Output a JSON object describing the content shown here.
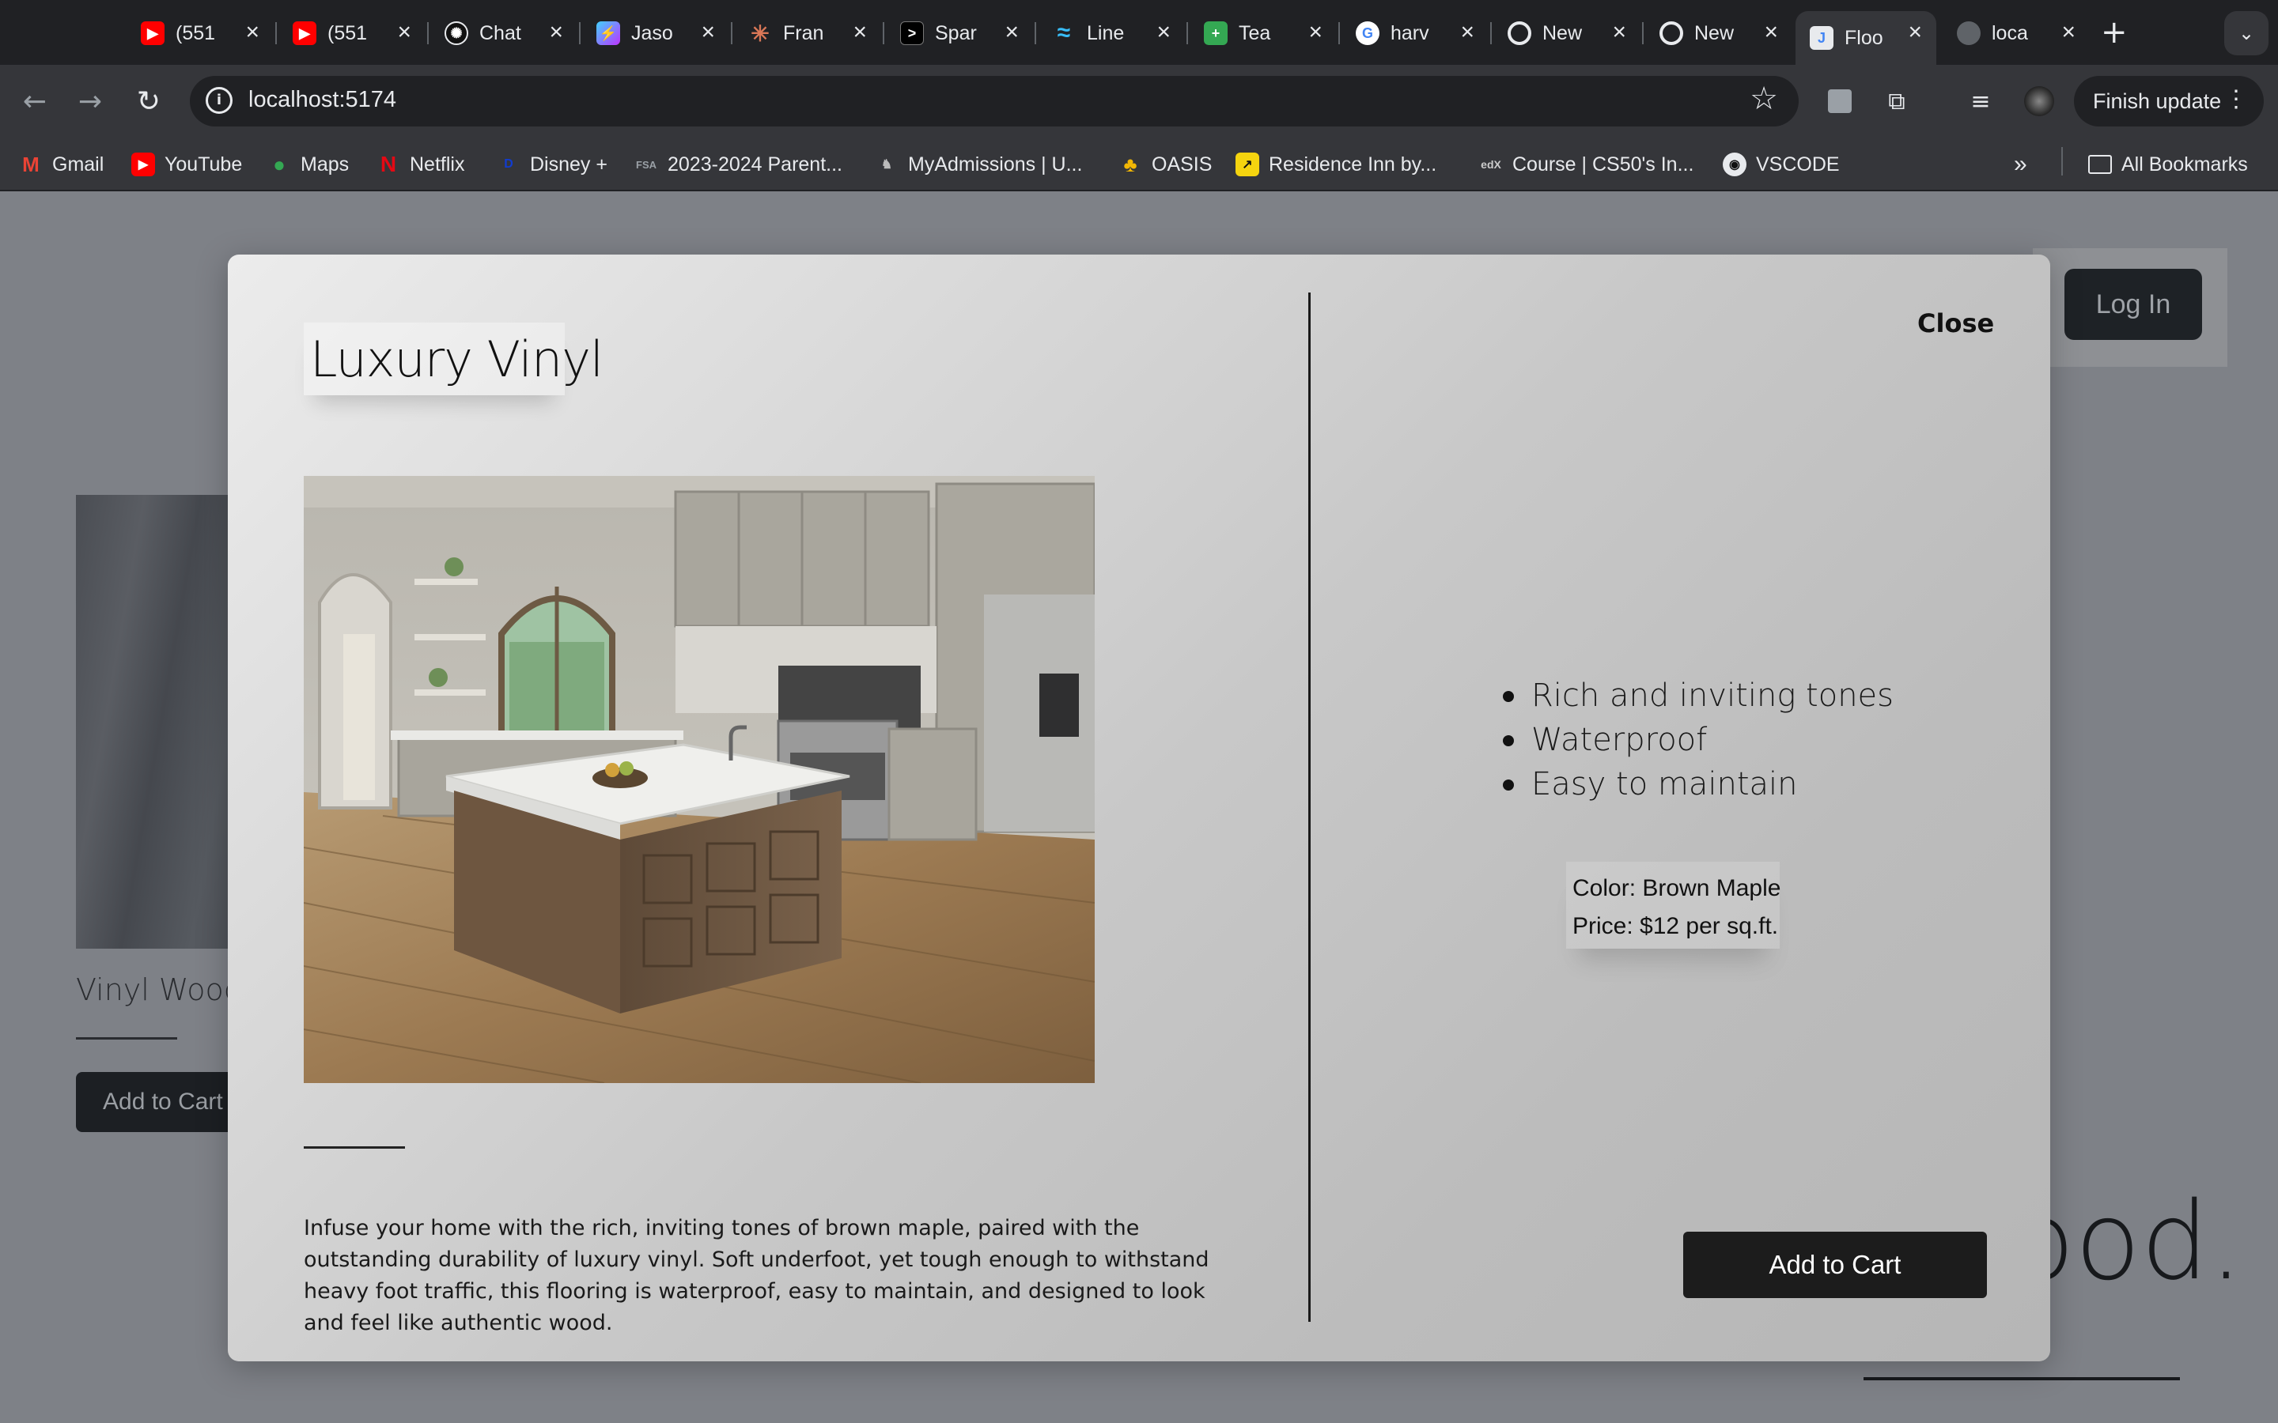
{
  "browser": {
    "tabs": [
      {
        "title": "(551",
        "icon": "youtube-icon",
        "color": "#ff0000"
      },
      {
        "title": "(551",
        "icon": "youtube-icon",
        "color": "#ff0000"
      },
      {
        "title": "Chat",
        "icon": "chatgpt-icon",
        "color": "#202124"
      },
      {
        "title": "Jaso",
        "icon": "vite-icon",
        "color": "#8b5cf6"
      },
      {
        "title": "Fran",
        "icon": "claude-icon",
        "color": "#d97757"
      },
      {
        "title": "Spar",
        "icon": "terminal-icon",
        "color": "#000000"
      },
      {
        "title": "Line",
        "icon": "tailwind-icon",
        "color": "#38bdf8"
      },
      {
        "title": "Tea",
        "icon": "sheets-icon",
        "color": "#34a853"
      },
      {
        "title": "harv",
        "icon": "google-icon",
        "color": "#4285f4"
      },
      {
        "title": "New",
        "icon": "chrome-icon",
        "color": "#e8eaed"
      },
      {
        "title": "New",
        "icon": "chrome-icon",
        "color": "#e8eaed"
      },
      {
        "title": "Floo",
        "icon": "page-icon",
        "color": "#4285f4",
        "active": true
      },
      {
        "title": "loca",
        "icon": "globe-icon",
        "color": "#9aa0a6"
      }
    ],
    "url": "localhost:5174",
    "finish_update": "Finish update",
    "bookmarks": [
      {
        "label": "Gmail",
        "icon": "gmail-icon"
      },
      {
        "label": "YouTube",
        "icon": "youtube-icon"
      },
      {
        "label": "Maps",
        "icon": "maps-icon"
      },
      {
        "label": "Netflix",
        "icon": "netflix-icon"
      },
      {
        "label": "Disney +",
        "icon": "disney-icon"
      },
      {
        "label": "2023-2024 Parent...",
        "icon": "fsa-icon"
      },
      {
        "label": "MyAdmissions | U...",
        "icon": "admissions-icon"
      },
      {
        "label": "OASIS",
        "icon": "palm-icon"
      },
      {
        "label": "Residence Inn by...",
        "icon": "marriott-icon"
      },
      {
        "label": "Course | CS50's In...",
        "icon": "edx-icon"
      },
      {
        "label": "VSCODE",
        "icon": "github-icon"
      }
    ],
    "all_bookmarks": "All Bookmarks"
  },
  "page": {
    "login": "Log In",
    "card_title": "Vinyl Wood",
    "card_button": "Add to Cart",
    "hero_fragment": "ood."
  },
  "modal": {
    "title": "Luxury Vinyl",
    "close": "Close",
    "features": [
      "Rich and inviting tones",
      "Waterproof",
      "Easy to maintain"
    ],
    "color": "Color: Brown Maple",
    "price": "Price: $12 per sq.ft.",
    "description": "Infuse your home with the rich, inviting tones of brown maple, paired with the outstanding durability of luxury vinyl. Soft underfoot, yet tough enough to withstand heavy foot traffic, this flooring is waterproof, easy to maintain, and designed to look and feel like authentic wood.",
    "add_to_cart": "Add to Cart"
  }
}
